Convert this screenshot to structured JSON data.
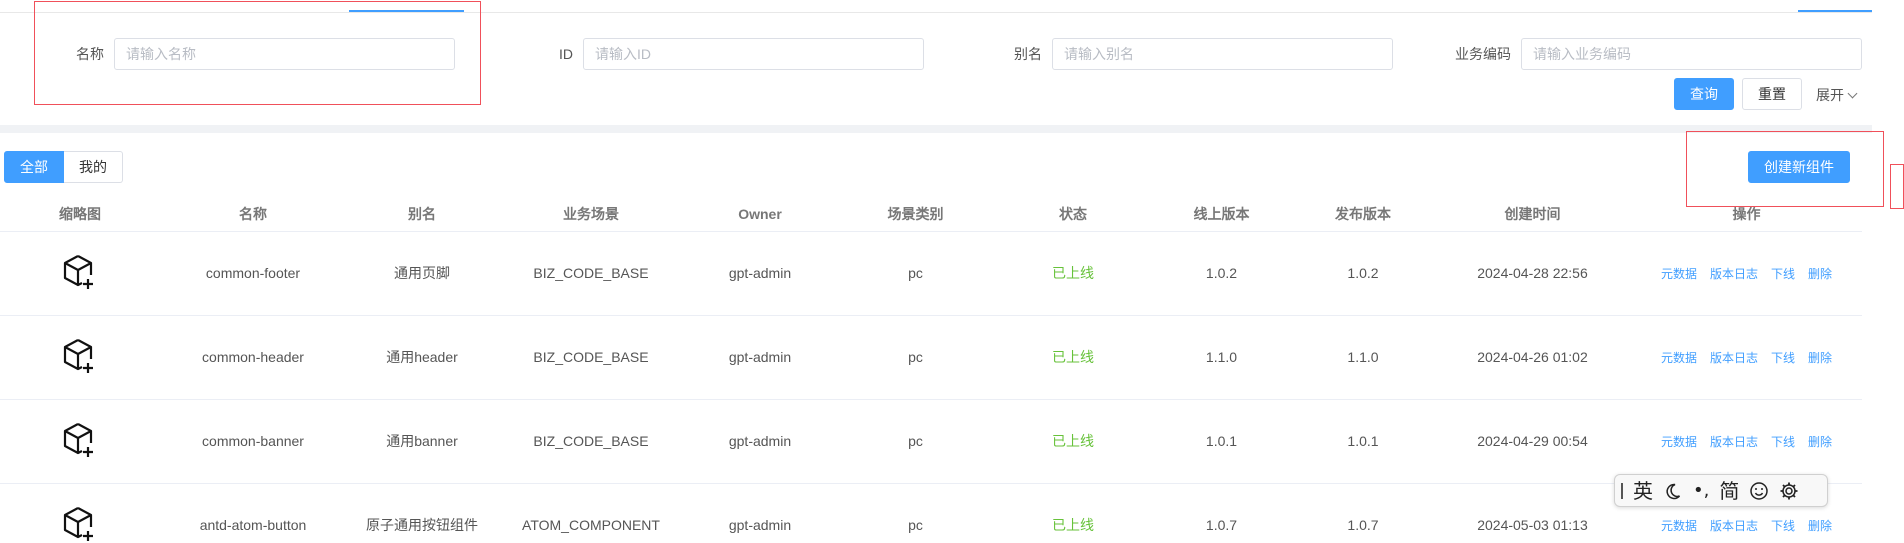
{
  "filters": {
    "name": {
      "label": "名称",
      "placeholder": "请输入名称"
    },
    "id": {
      "label": "ID",
      "placeholder": "请输入ID"
    },
    "alias": {
      "label": "别名",
      "placeholder": "请输入别名"
    },
    "biz_code": {
      "label": "业务编码",
      "placeholder": "请输入业务编码"
    },
    "query_label": "查询",
    "reset_label": "重置",
    "expand_label": "展开"
  },
  "segments": {
    "all": "全部",
    "mine": "我的"
  },
  "create_label": "创建新组件",
  "table": {
    "columns": [
      "缩略图",
      "名称",
      "别名",
      "业务场景",
      "Owner",
      "场景类别",
      "状态",
      "线上版本",
      "发布版本",
      "创建时间",
      "操作"
    ],
    "rows": [
      {
        "name": "common-footer",
        "alias": "通用页脚",
        "biz": "BIZ_CODE_BASE",
        "owner": "gpt-admin",
        "scene": "pc",
        "status": "已上线",
        "online": "1.0.2",
        "release": "1.0.2",
        "created": "2024-04-28 22:56"
      },
      {
        "name": "common-header",
        "alias": "通用header",
        "biz": "BIZ_CODE_BASE",
        "owner": "gpt-admin",
        "scene": "pc",
        "status": "已上线",
        "online": "1.1.0",
        "release": "1.1.0",
        "created": "2024-04-26 01:02"
      },
      {
        "name": "common-banner",
        "alias": "通用banner",
        "biz": "BIZ_CODE_BASE",
        "owner": "gpt-admin",
        "scene": "pc",
        "status": "已上线",
        "online": "1.0.1",
        "release": "1.0.1",
        "created": "2024-04-29 00:54"
      },
      {
        "name": "antd-atom-button",
        "alias": "原子通用按钮组件",
        "biz": "ATOM_COMPONENT",
        "owner": "gpt-admin",
        "scene": "pc",
        "status": "已上线",
        "online": "1.0.7",
        "release": "1.0.7",
        "created": "2024-05-03 01:13"
      }
    ],
    "ops": [
      "元数据",
      "版本日志",
      "下线",
      "删除"
    ]
  },
  "ime": {
    "lang": "英",
    "punct": "•,",
    "simplified": "简"
  },
  "colors": {
    "primary": "#409eff",
    "online": "#67c23a",
    "highlight": "#f0505a"
  }
}
